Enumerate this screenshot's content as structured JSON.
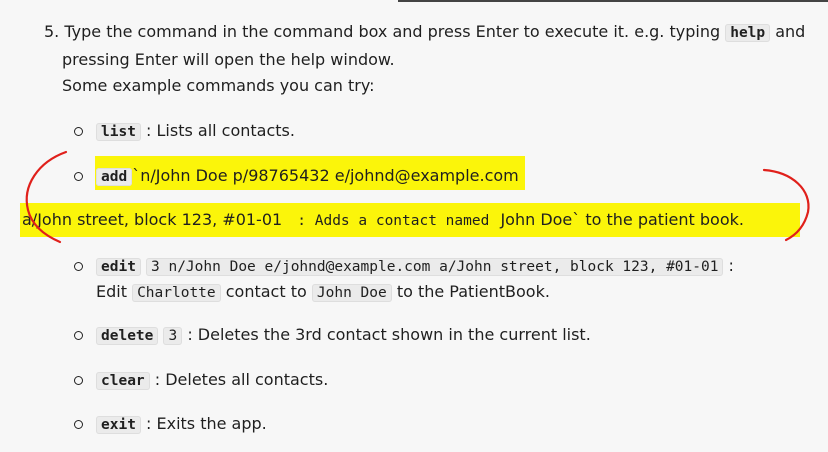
{
  "step": {
    "number": "5.",
    "text_before_help": "Type the command in the command box and press Enter to execute it. e.g. typing",
    "help_code": "help",
    "text_after_help": "and",
    "line2": "pressing Enter will open the help window.",
    "line3": "Some example commands you can try:"
  },
  "commands": {
    "list": {
      "code": "list",
      "desc": ": Lists all contacts."
    },
    "add": {
      "code": "add",
      "args_line1": "`n/John Doe p/98765432 e/johnd@example.com",
      "args_line2": "a/John street, block 123, #01-01",
      "desc_code": ": Adds a contact named",
      "desc_text": "John Doe` to the patient book."
    },
    "edit": {
      "code": "edit",
      "args_code": "3 n/John Doe e/johnd@example.com a/John street, block 123, #01-01",
      "colon": ":",
      "edit_word": "Edit",
      "name_code": "Charlotte",
      "contact_to": "contact to",
      "john_code": "John Doe",
      "tail": "to the PatientBook."
    },
    "delete": {
      "code": "delete",
      "index_code": "3",
      "desc": ": Deletes the 3rd contact shown in the current list."
    },
    "clear": {
      "code": "clear",
      "desc": ": Deletes all contacts."
    },
    "exit": {
      "code": "exit",
      "desc": ": Exits the app."
    }
  },
  "annotation_colors": {
    "highlight": "#fbf50a",
    "pen": "#e0201b"
  }
}
